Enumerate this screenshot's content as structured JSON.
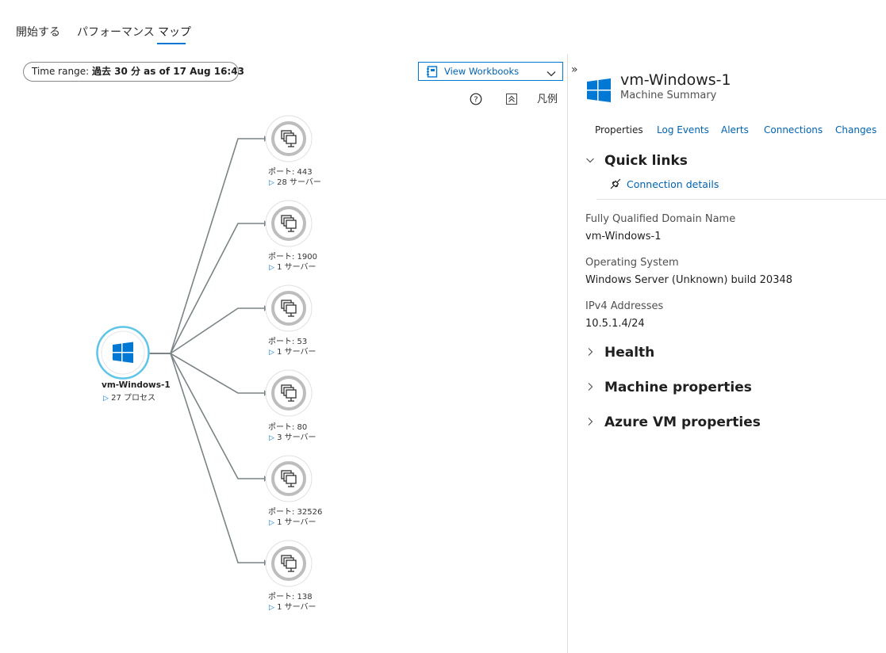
{
  "tabs": [
    {
      "label": "開始する"
    },
    {
      "label": "パフォーマンス"
    },
    {
      "label": "マップ"
    }
  ],
  "time_range": {
    "label": "Time range:",
    "value": "過去 30 分 as of 17 Aug 16:43"
  },
  "workbooks": {
    "label": "View Workbooks"
  },
  "collapse_label": "»",
  "toolbar": {
    "legend_label": "凡例"
  },
  "map": {
    "vm": {
      "name": "vm-Windows-1",
      "sub": "27 プロセス"
    },
    "ports": [
      {
        "label": "ポート: 443",
        "sub": "28 サーバー"
      },
      {
        "label": "ポート: 1900",
        "sub": "1 サーバー"
      },
      {
        "label": "ポート: 53",
        "sub": "1 サーバー"
      },
      {
        "label": "ポート: 80",
        "sub": "3 サーバー"
      },
      {
        "label": "ポート: 32526",
        "sub": "1 サーバー"
      },
      {
        "label": "ポート: 138",
        "sub": "1 サーバー"
      }
    ]
  },
  "panel": {
    "title": "vm-Windows-1",
    "subtitle": "Machine Summary",
    "tabs": [
      {
        "label": "Properties"
      },
      {
        "label": "Log Events"
      },
      {
        "label": "Alerts"
      },
      {
        "label": "Connections"
      },
      {
        "label": "Changes"
      }
    ],
    "quick_links": {
      "title": "Quick links",
      "link": "Connection details"
    },
    "properties": [
      {
        "label": "Fully Qualified Domain Name",
        "value": "vm-Windows-1"
      },
      {
        "label": "Operating System",
        "value": "Windows Server (Unknown) build 20348"
      },
      {
        "label": "IPv4 Addresses",
        "value": "10.5.1.4/24"
      }
    ],
    "sections": [
      {
        "title": "Health"
      },
      {
        "title": "Machine properties"
      },
      {
        "title": "Azure VM properties"
      }
    ]
  },
  "colors": {
    "accent": "#0078d4",
    "vm_ring": "#5ec5e8",
    "link_line": "#7a8386",
    "node_ring": "#bdbdbd"
  }
}
